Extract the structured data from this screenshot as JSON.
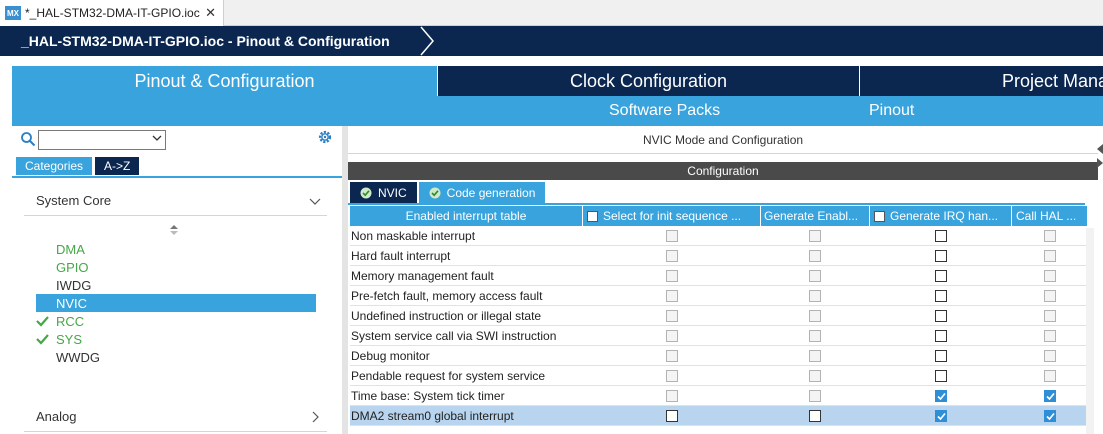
{
  "editor_tab": {
    "icon_text": "MX",
    "label": "*_HAL-STM32-DMA-IT-GPIO.ioc",
    "close": "✕"
  },
  "breadcrumb": {
    "text": "_HAL-STM32-DMA-IT-GPIO.ioc - Pinout & Configuration"
  },
  "main_tabs": [
    {
      "label": "Pinout & Configuration",
      "active": true
    },
    {
      "label": "Clock Configuration",
      "active": false
    },
    {
      "label": "Project Mana",
      "active": false
    }
  ],
  "sub_tabs": [
    {
      "label": "Software Packs"
    },
    {
      "label": "Pinout"
    }
  ],
  "left": {
    "search": {
      "value": ""
    },
    "category_tabs": [
      {
        "label": "Categories",
        "active": true
      },
      {
        "label": "A->Z",
        "active": false
      }
    ],
    "sections": [
      {
        "label": "System Core",
        "expanded": true
      },
      {
        "label": "Analog",
        "expanded": false
      }
    ],
    "peripherals": [
      {
        "label": "DMA",
        "style": "green",
        "checked": false
      },
      {
        "label": "GPIO",
        "style": "green",
        "checked": false
      },
      {
        "label": "IWDG",
        "style": "plain",
        "checked": false
      },
      {
        "label": "NVIC",
        "style": "selected",
        "checked": false
      },
      {
        "label": "RCC",
        "style": "green",
        "checked": true
      },
      {
        "label": "SYS",
        "style": "green",
        "checked": true
      },
      {
        "label": "WWDG",
        "style": "plain",
        "checked": false
      }
    ]
  },
  "right": {
    "mode_title": "NVIC Mode and Configuration",
    "config_bar": "Configuration",
    "config_tabs": [
      {
        "label": "NVIC",
        "active": true
      },
      {
        "label": "Code generation",
        "active": false
      }
    ],
    "columns": [
      {
        "label": "Enabled interrupt table",
        "checkbox": false
      },
      {
        "label": "Select for init sequence ...",
        "checkbox": true
      },
      {
        "label": "Generate Enabl...",
        "checkbox": false
      },
      {
        "label": "Generate IRQ han...",
        "checkbox": true
      },
      {
        "label": "Call HAL ...",
        "checkbox": false
      }
    ],
    "rows": [
      {
        "name": "Non maskable interrupt",
        "cells": [
          "disabled",
          "disabled",
          "enabled",
          "disabled"
        ]
      },
      {
        "name": "Hard fault interrupt",
        "cells": [
          "disabled",
          "disabled",
          "enabled",
          "disabled"
        ]
      },
      {
        "name": "Memory management fault",
        "cells": [
          "disabled",
          "disabled",
          "enabled",
          "disabled"
        ]
      },
      {
        "name": "Pre-fetch fault, memory access fault",
        "cells": [
          "disabled",
          "disabled",
          "enabled",
          "disabled"
        ]
      },
      {
        "name": "Undefined instruction or illegal state",
        "cells": [
          "disabled",
          "disabled",
          "enabled",
          "disabled"
        ]
      },
      {
        "name": "System service call via SWI instruction",
        "cells": [
          "disabled",
          "disabled",
          "enabled",
          "disabled"
        ]
      },
      {
        "name": "Debug monitor",
        "cells": [
          "disabled",
          "disabled",
          "enabled",
          "disabled"
        ]
      },
      {
        "name": "Pendable request for system service",
        "cells": [
          "disabled",
          "disabled",
          "enabled",
          "disabled"
        ]
      },
      {
        "name": "Time base: System tick timer",
        "cells": [
          "disabled",
          "disabled",
          "checked",
          "checked"
        ]
      },
      {
        "name": "DMA2 stream0 global interrupt",
        "cells": [
          "enabled",
          "enabled",
          "checked",
          "checked"
        ],
        "selected": true
      }
    ]
  },
  "colors": {
    "navy": "#0b2750",
    "accent": "#38a3dc",
    "green": "#46a746",
    "check_blue": "#2f8fd6"
  }
}
